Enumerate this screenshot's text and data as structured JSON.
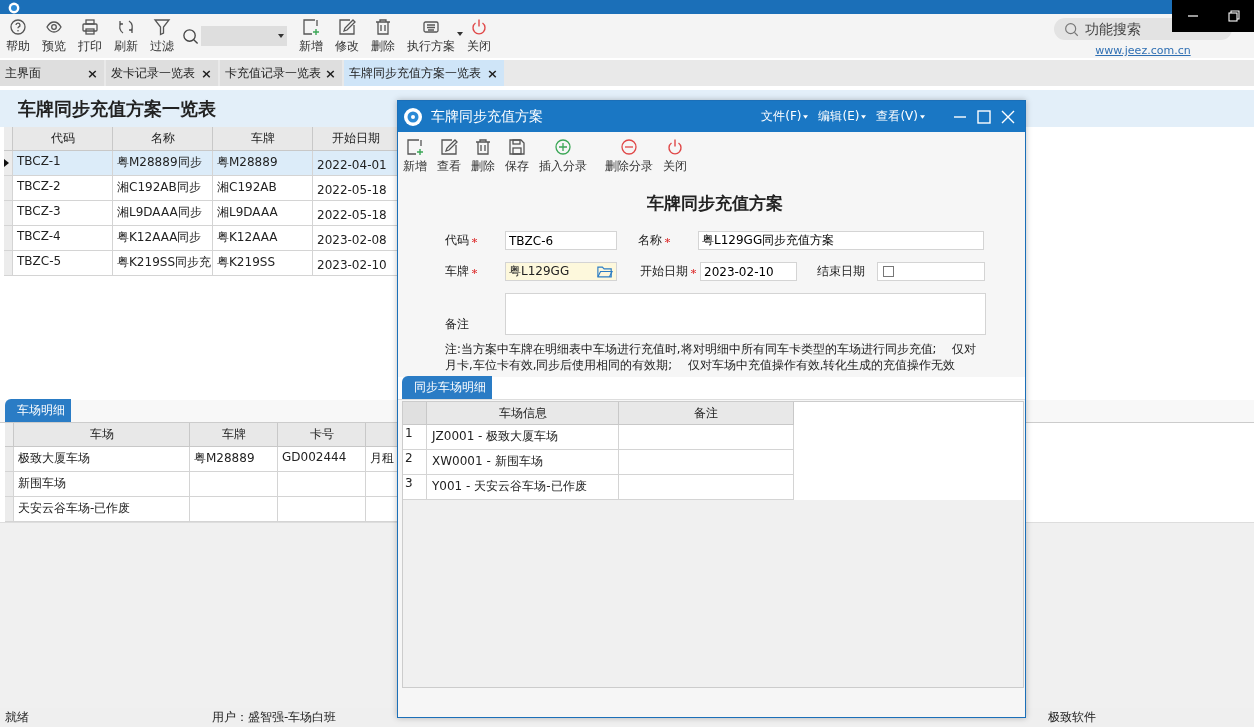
{
  "toolbar": {
    "left_buttons": [
      {
        "label": "帮助"
      },
      {
        "label": "预览"
      },
      {
        "label": "打印"
      },
      {
        "label": "刷新"
      },
      {
        "label": "过滤"
      }
    ],
    "right_buttons": [
      {
        "label": "新增",
        "has_menu": false
      },
      {
        "label": "修改",
        "has_menu": false
      },
      {
        "label": "删除",
        "has_menu": false
      },
      {
        "label": "执行方案",
        "has_menu": true
      },
      {
        "label": "关闭",
        "has_menu": false
      }
    ],
    "function_search": {
      "placeholder": "功能搜索"
    },
    "website_link": "www.jeez.com.cn"
  },
  "tabs": [
    {
      "label": "主界面",
      "selected": false,
      "close": "×"
    },
    {
      "label": "发卡记录一览表",
      "selected": false,
      "close": "×"
    },
    {
      "label": "卡充值记录一览表",
      "selected": false,
      "close": "×"
    },
    {
      "label": "车牌同步充值方案一览表",
      "selected": true,
      "close": "×"
    }
  ],
  "page_title": "车牌同步充值方案一览表",
  "table": {
    "columns": [
      "代码",
      "名称",
      "车牌",
      "开始日期"
    ],
    "rows": [
      {
        "cells": [
          "TBCZ-1",
          "粤M28889同步",
          "粤M28889",
          "2022-04-01"
        ],
        "selected": true
      },
      {
        "cells": [
          "TBCZ-2",
          "湘C192AB同步",
          "湘C192AB",
          "2022-05-18"
        ],
        "selected": false
      },
      {
        "cells": [
          "TBCZ-3",
          "湘L9DAAA同步",
          "湘L9DAAA",
          "2022-05-18"
        ],
        "selected": false
      },
      {
        "cells": [
          "TBCZ-4",
          "粤K12AAA同步",
          "粤K12AAA",
          "2023-02-08"
        ],
        "selected": false
      },
      {
        "cells": [
          "TBZC-5",
          "粤K219SS同步充",
          "粤K219SS",
          "2023-02-10"
        ],
        "selected": false
      }
    ]
  },
  "detail": {
    "tab": {
      "label": "车场明细",
      "selected": true
    },
    "columns": [
      "车场",
      "车牌",
      "卡号"
    ],
    "rows": [
      {
        "cells": [
          "极致大厦车场",
          "粤M28889",
          "GD002444",
          "月租"
        ]
      },
      {
        "cells": [
          "新围车场",
          "",
          "",
          ""
        ]
      },
      {
        "cells": [
          "天安云谷车场-已作废",
          "",
          "",
          ""
        ]
      }
    ]
  },
  "status_bar": [
    "就绪",
    "用户：盛智强-车场白班",
    "极致软件"
  ],
  "dialog": {
    "title": "车牌同步充值方案",
    "menus": [
      "文件(F)",
      "编辑(E)",
      "查看(V)"
    ],
    "toolbar": [
      {
        "label": "新增"
      },
      {
        "label": "查看"
      },
      {
        "label": "删除"
      },
      {
        "label": "保存"
      },
      {
        "label": "插入分录"
      },
      {
        "label": "删除分录"
      },
      {
        "label": "关闭"
      }
    ],
    "form_title": "车牌同步充值方案",
    "fields": {
      "code": {
        "label": "代码",
        "required": true,
        "value": "TBZC-6"
      },
      "name": {
        "label": "名称",
        "required": true,
        "value": "粤L129GG同步充值方案"
      },
      "plate": {
        "label": "车牌",
        "required": true,
        "value": "粤L129GG"
      },
      "start_date": {
        "label": "开始日期",
        "required": true,
        "value": "2023-02-10"
      },
      "end_date": {
        "label": "结束日期",
        "required": false,
        "checked": false
      },
      "remark": {
        "label": "备注"
      }
    },
    "note": "注:当方案中车牌在明细表中车场进行充值时,将对明细中所有同车卡类型的车场进行同步充值;　 仅对月卡,车位卡有效,同步后使用相同的有效期;　 仅对车场中充值操作有效,转化生成的充值操作无效",
    "detail": {
      "tab": {
        "label": "同步车场明细",
        "selected": true
      },
      "columns": [
        "车场信息",
        "备注"
      ],
      "rows": [
        {
          "number": "1",
          "cells": [
            "JZ0001 - 极致大厦车场",
            ""
          ]
        },
        {
          "number": "2",
          "cells": [
            "XW0001 - 新围车场",
            ""
          ]
        },
        {
          "number": "3",
          "cells": [
            "Y001 - 天安云谷车场-已作废",
            ""
          ]
        }
      ]
    }
  }
}
